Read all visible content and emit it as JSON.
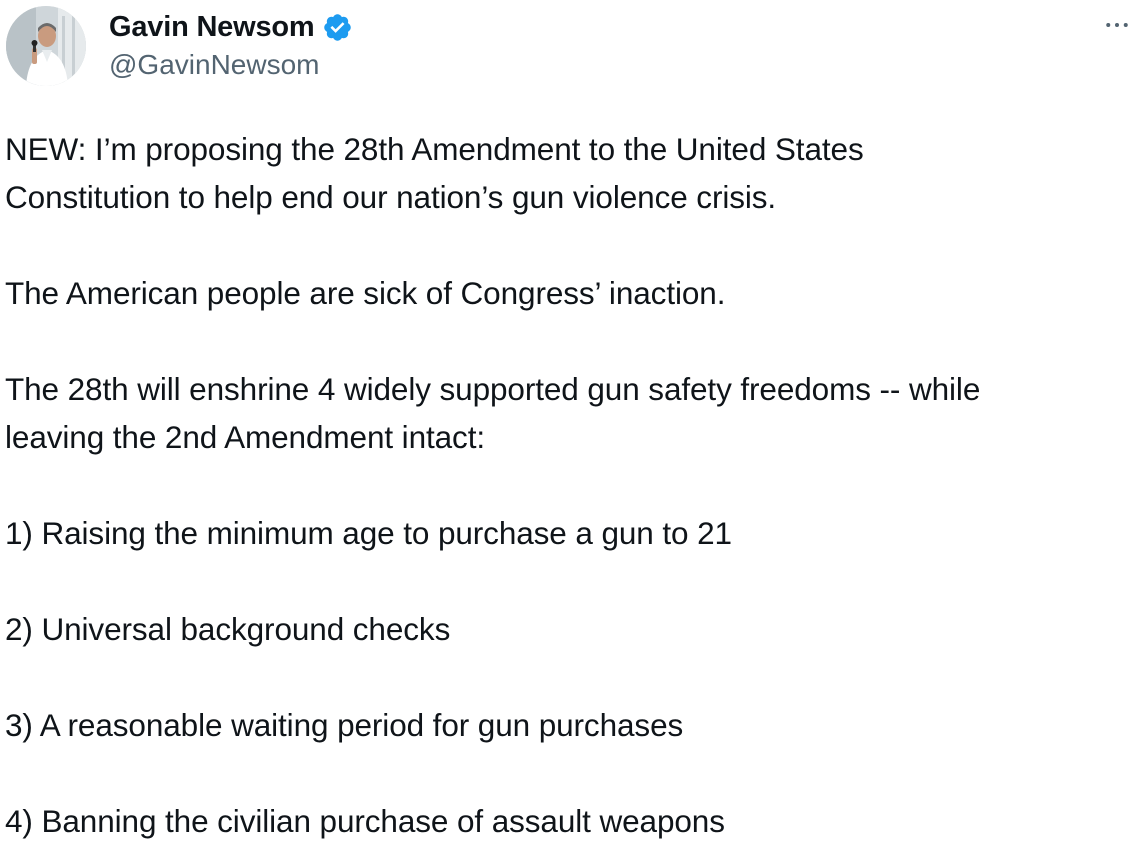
{
  "author": {
    "display_name": "Gavin Newsom",
    "handle": "@GavinNewsom",
    "verified_icon": "verified-badge-icon",
    "avatar": "profile-photo"
  },
  "menu": {
    "more_icon": "more-horizontal-icon"
  },
  "colors": {
    "text": "#0f1419",
    "secondary": "#536471",
    "verified": "#1d9bf0"
  },
  "tweet": {
    "paragraphs": [
      {
        "lines": [
          "NEW: I’m proposing the 28th Amendment to the United States",
          "Constitution to help end our nation’s gun violence crisis."
        ]
      },
      {
        "lines": [
          "The American people are sick of Congress’ inaction."
        ]
      },
      {
        "lines": [
          "The 28th will enshrine 4 widely supported gun safety freedoms -- while",
          "leaving the 2nd Amendment intact:"
        ]
      },
      {
        "lines": [
          "1) Raising the minimum age to purchase a gun to 21"
        ]
      },
      {
        "lines": [
          "2) Universal background checks"
        ]
      },
      {
        "lines": [
          "3) A reasonable waiting period for gun purchases"
        ]
      },
      {
        "lines": [
          "4) Banning the civilian purchase of assault weapons"
        ]
      }
    ]
  }
}
